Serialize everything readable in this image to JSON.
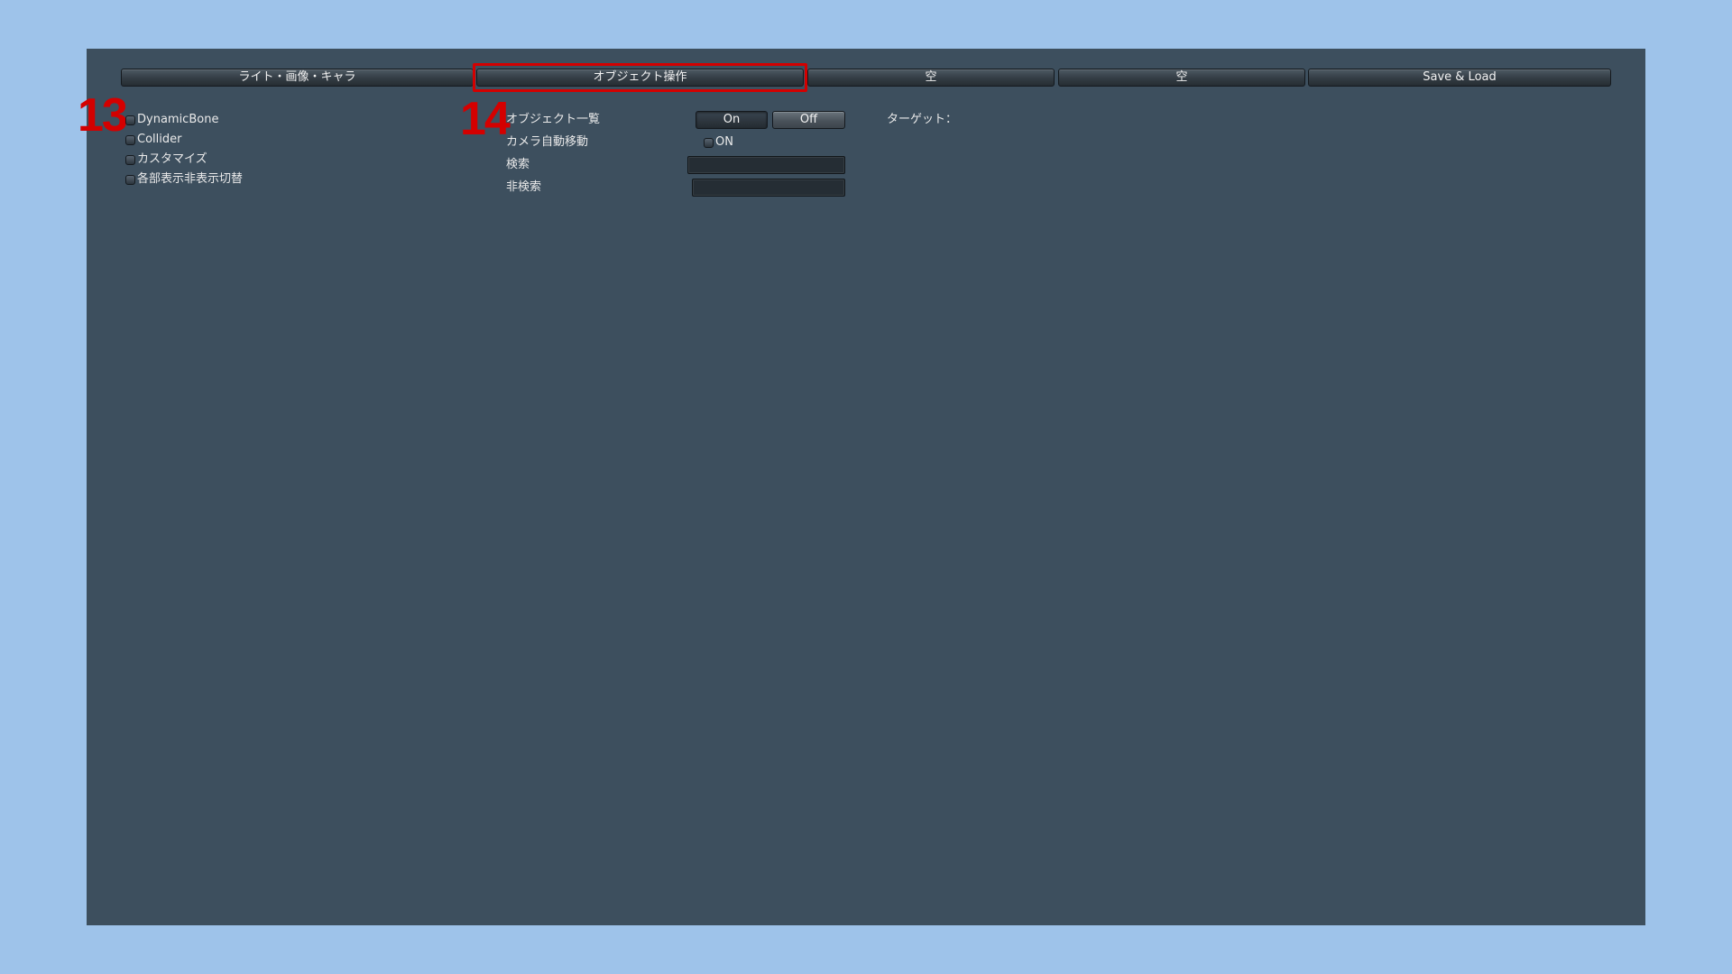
{
  "tabs": [
    {
      "label": "ライト・画像・キャラ"
    },
    {
      "label": "オブジェクト操作"
    },
    {
      "label": "空"
    },
    {
      "label": "空"
    },
    {
      "label": "Save & Load"
    }
  ],
  "annotations": {
    "left_marker": "13",
    "center_marker": "14",
    "highlight_color": "#d40000"
  },
  "left_column": {
    "items": [
      {
        "label": "DynamicBone"
      },
      {
        "label": "Collider"
      },
      {
        "label": "カスタマイズ"
      },
      {
        "label": "各部表示非表示切替"
      }
    ]
  },
  "object_panel": {
    "list_label": "オブジェクト一覧",
    "on_button": "On",
    "off_button": "Off",
    "camera_label": "カメラ自動移動",
    "camera_toggle_label": "ON",
    "search_label": "検索",
    "search_value": "",
    "exclude_label": "非検索",
    "exclude_value": "",
    "target_label": "ターゲット："
  },
  "colors": {
    "background": "#9ec3ea",
    "panel": "#3d4f5e",
    "text": "#eaeaea"
  }
}
